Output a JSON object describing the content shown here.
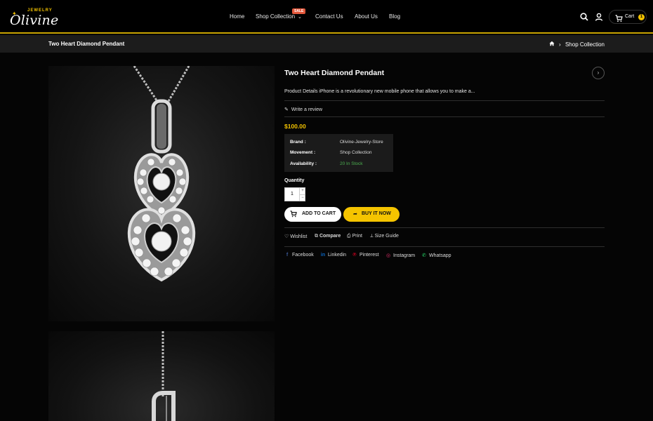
{
  "header": {
    "logo_main": "Olivine",
    "logo_sub": "JEWELRY",
    "nav": [
      "Home",
      "Shop Collection",
      "Contact Us",
      "About Us",
      "Blog"
    ],
    "sale_badge": "SALE",
    "cart_label": "Cart",
    "cart_count": "1"
  },
  "breadcrumb": {
    "page_title": "Two Heart Diamond Pendant",
    "current": "Shop Collection"
  },
  "product": {
    "title": "Two Heart Diamond Pendant",
    "description": "Product Details iPhone is a revolutionary new mobile phone that allows you to make a...",
    "write_review": "Write a review",
    "price": "$100.00",
    "details": [
      {
        "key": "Brand :",
        "value": "Olivine-Jewelry-Store"
      },
      {
        "key": "Movement :",
        "value": "Shop Collection"
      },
      {
        "key": "Availability :",
        "value": "20 In Stock"
      }
    ],
    "quantity_label": "Quantity",
    "quantity_value": "1",
    "add_to_cart": "ADD TO CART",
    "buy_now": "BUY IT NOW",
    "actions": [
      "Wishlist",
      "Compare",
      "Print",
      "Size Guide"
    ],
    "social": [
      "Facebook",
      "Linkedin",
      "Pinterest",
      "Instagram",
      "Whatsapp"
    ]
  },
  "colors": {
    "accent": "#f5c400",
    "sale": "#e2573b",
    "in_stock": "#4caf50"
  }
}
